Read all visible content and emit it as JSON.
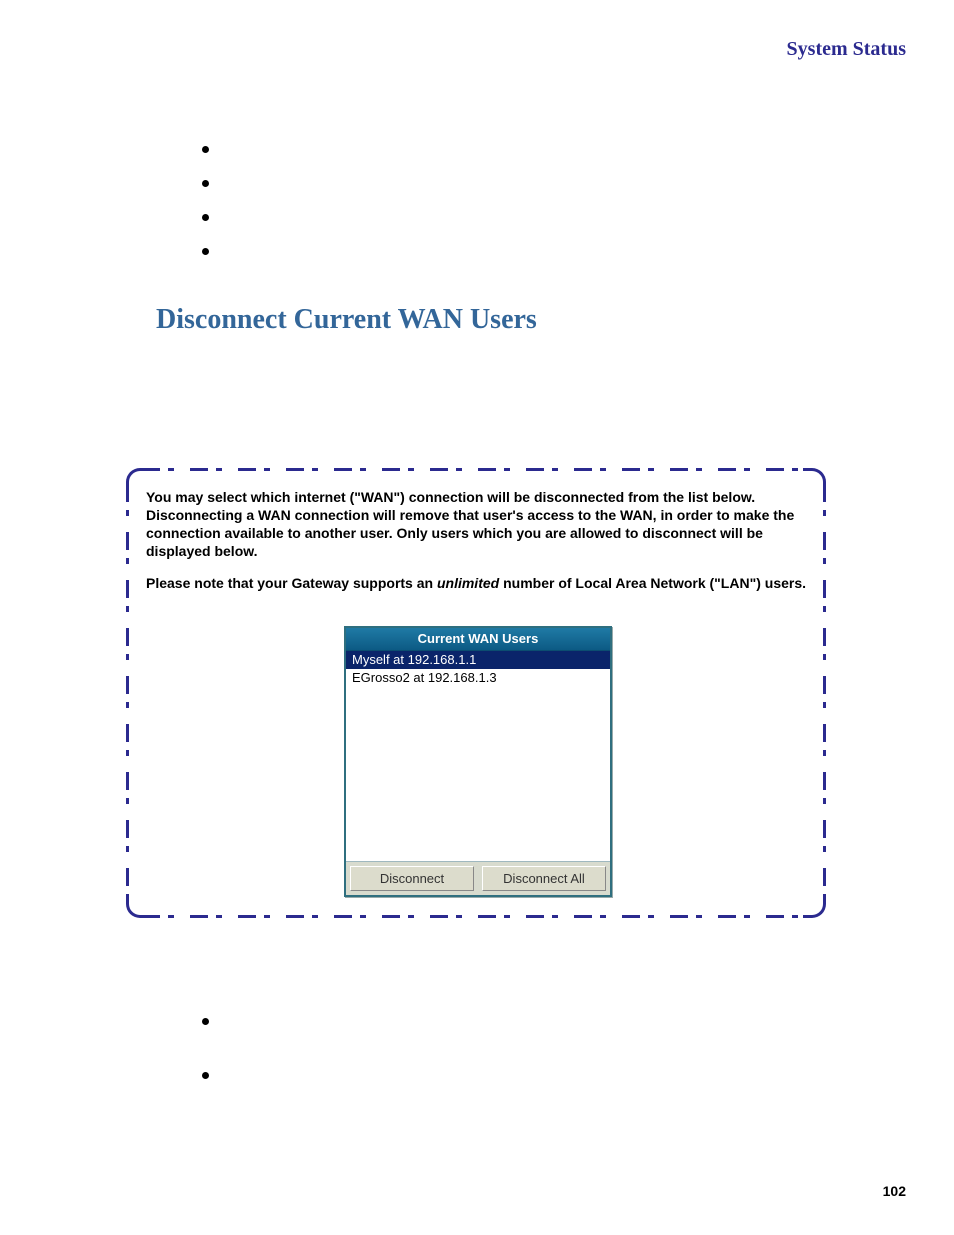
{
  "header": {
    "right_title": "System Status"
  },
  "section": {
    "title": "Disconnect Current WAN Users"
  },
  "panel": {
    "para1_pre": "You may select which internet (\"WAN\") connection will be disconnected from the list below. Disconnecting a WAN connection will remove that user's access to the WAN, in order to make the connection available to another user. Only users which you are allowed to disconnect will be displayed below.",
    "para2_pre": "Please note that your Gateway supports an ",
    "para2_em": "unlimited",
    "para2_post": " number of Local Area Network (\"LAN\") users.",
    "widget": {
      "title": "Current WAN Users",
      "items": [
        {
          "label": "Myself at 192.168.1.1",
          "selected": true
        },
        {
          "label": "EGrosso2 at 192.168.1.3",
          "selected": false
        }
      ],
      "buttons": {
        "disconnect": "Disconnect",
        "disconnect_all": "Disconnect All"
      }
    }
  },
  "footer": {
    "page_number": "102"
  }
}
